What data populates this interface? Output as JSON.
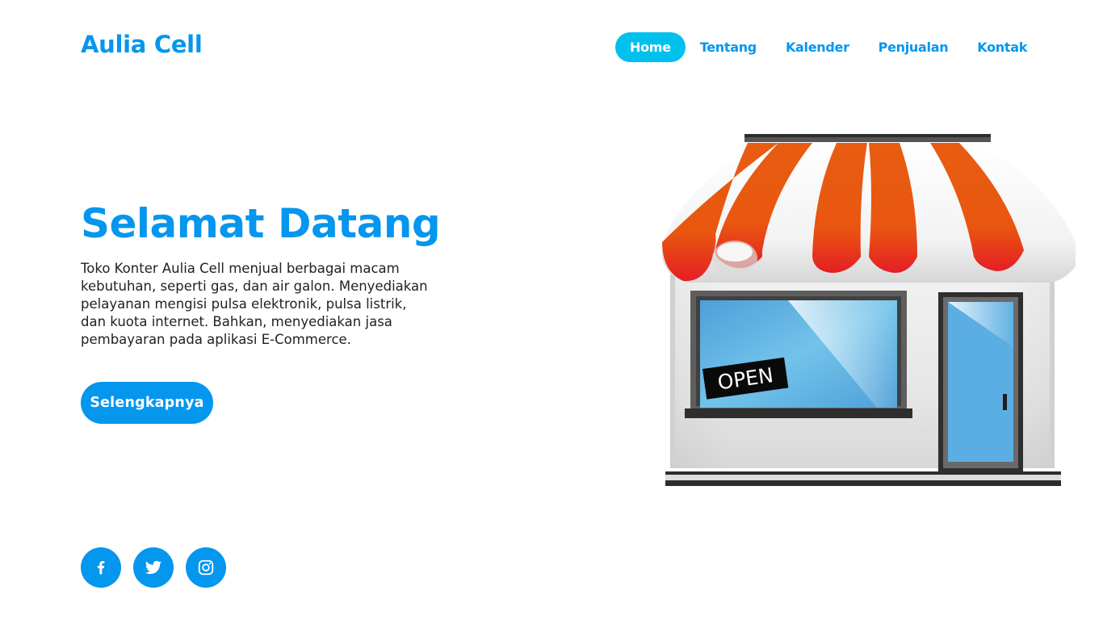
{
  "brand": {
    "name": "Aulia Cell"
  },
  "nav": {
    "items": [
      {
        "label": "Home",
        "active": true
      },
      {
        "label": "Tentang",
        "active": false
      },
      {
        "label": "Kalender",
        "active": false
      },
      {
        "label": "Penjualan",
        "active": false
      },
      {
        "label": "Kontak",
        "active": false
      }
    ]
  },
  "hero": {
    "title": "Selamat Datang",
    "description": "Toko Konter Aulia Cell menjual berbagai macam kebutuhan, seperti gas, dan air galon. Menyediakan pelayanan mengisi pulsa elektronik, pulsa listrik, dan kuota internet. Bahkan, menyediakan jasa pembayaran pada aplikasi E-Commerce.",
    "button_label": "Selengkapnya"
  },
  "illustration": {
    "sign_text": "OPEN",
    "icon": "storefront-illustration"
  },
  "social": {
    "items": [
      {
        "icon": "facebook-icon"
      },
      {
        "icon": "twitter-icon"
      },
      {
        "icon": "instagram-icon"
      }
    ]
  },
  "colors": {
    "primary": "#0596ee",
    "nav_active_bg": "#00c1ec",
    "awning_orange": "#e85d12",
    "awning_red": "#e61e25",
    "glass_blue": "#5aaee3"
  }
}
